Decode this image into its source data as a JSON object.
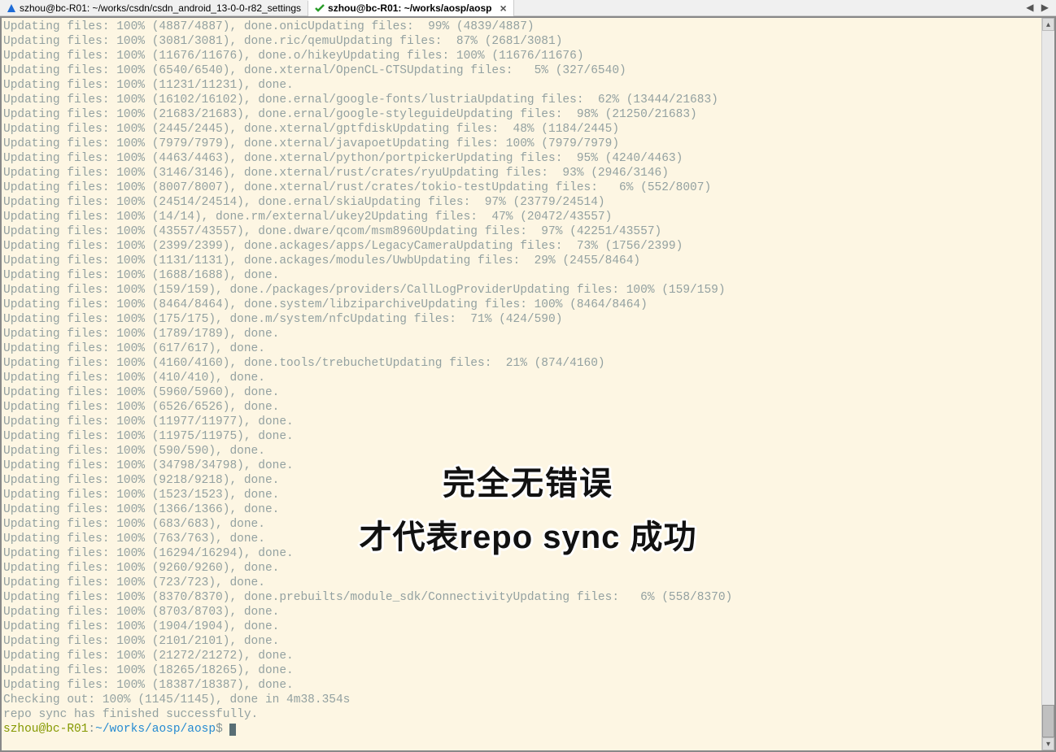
{
  "tabs": [
    {
      "icon": "triangle-blue",
      "label": "szhou@bc-R01: ~/works/csdn/csdn_android_13-0-0-r82_settings",
      "active": false
    },
    {
      "icon": "check-green",
      "label": "szhou@bc-R01: ~/works/aosp/aosp",
      "active": true
    }
  ],
  "overlay": {
    "line1": "完全无错误",
    "line2": "才代表repo sync 成功"
  },
  "prompt": {
    "user": "szhou",
    "host": "bc-R01",
    "path": "~/works/aosp/aosp",
    "symbol": "$"
  },
  "checkout_line": "Checking out: 100% (1145/1145), done in 4m38.354s",
  "finish_line": "repo sync has finished successfully.",
  "lines": [
    "Updating files: 100% (4887/4887), done.onicUpdating files:  99% (4839/4887)",
    "Updating files: 100% (3081/3081), done.ric/qemuUpdating files:  87% (2681/3081)",
    "Updating files: 100% (11676/11676), done.o/hikeyUpdating files: 100% (11676/11676)",
    "Updating files: 100% (6540/6540), done.xternal/OpenCL-CTSUpdating files:   5% (327/6540)",
    "Updating files: 100% (11231/11231), done.",
    "Updating files: 100% (16102/16102), done.ernal/google-fonts/lustriaUpdating files:  62% (13444/21683)",
    "Updating files: 100% (21683/21683), done.ernal/google-styleguideUpdating files:  98% (21250/21683)",
    "Updating files: 100% (2445/2445), done.xternal/gptfdiskUpdating files:  48% (1184/2445)",
    "Updating files: 100% (7979/7979), done.xternal/javapoetUpdating files: 100% (7979/7979)",
    "Updating files: 100% (4463/4463), done.xternal/python/portpickerUpdating files:  95% (4240/4463)",
    "Updating files: 100% (3146/3146), done.xternal/rust/crates/ryuUpdating files:  93% (2946/3146)",
    "Updating files: 100% (8007/8007), done.xternal/rust/crates/tokio-testUpdating files:   6% (552/8007)",
    "Updating files: 100% (24514/24514), done.ernal/skiaUpdating files:  97% (23779/24514)",
    "Updating files: 100% (14/14), done.rm/external/ukey2Updating files:  47% (20472/43557)",
    "Updating files: 100% (43557/43557), done.dware/qcom/msm8960Updating files:  97% (42251/43557)",
    "Updating files: 100% (2399/2399), done.ackages/apps/LegacyCameraUpdating files:  73% (1756/2399)",
    "Updating files: 100% (1131/1131), done.ackages/modules/UwbUpdating files:  29% (2455/8464)",
    "Updating files: 100% (1688/1688), done.",
    "Updating files: 100% (159/159), done./packages/providers/CallLogProviderUpdating files: 100% (159/159)",
    "Updating files: 100% (8464/8464), done.system/libziparchiveUpdating files: 100% (8464/8464)",
    "Updating files: 100% (175/175), done.m/system/nfcUpdating files:  71% (424/590)",
    "Updating files: 100% (1789/1789), done.",
    "Updating files: 100% (617/617), done.",
    "Updating files: 100% (4160/4160), done.tools/trebuchetUpdating files:  21% (874/4160)",
    "Updating files: 100% (410/410), done.",
    "Updating files: 100% (5960/5960), done.",
    "Updating files: 100% (6526/6526), done.",
    "Updating files: 100% (11977/11977), done.",
    "Updating files: 100% (11975/11975), done.",
    "Updating files: 100% (590/590), done.",
    "Updating files: 100% (34798/34798), done.",
    "Updating files: 100% (9218/9218), done.",
    "Updating files: 100% (1523/1523), done.",
    "Updating files: 100% (1366/1366), done.",
    "Updating files: 100% (683/683), done.",
    "Updating files: 100% (763/763), done.",
    "Updating files: 100% (16294/16294), done.",
    "Updating files: 100% (9260/9260), done.",
    "Updating files: 100% (723/723), done.",
    "Updating files: 100% (8370/8370), done.prebuilts/module_sdk/ConnectivityUpdating files:   6% (558/8370)",
    "Updating files: 100% (8703/8703), done.",
    "Updating files: 100% (1904/1904), done.",
    "Updating files: 100% (2101/2101), done.",
    "Updating files: 100% (21272/21272), done.",
    "Updating files: 100% (18265/18265), done.",
    "Updating files: 100% (18387/18387), done."
  ]
}
